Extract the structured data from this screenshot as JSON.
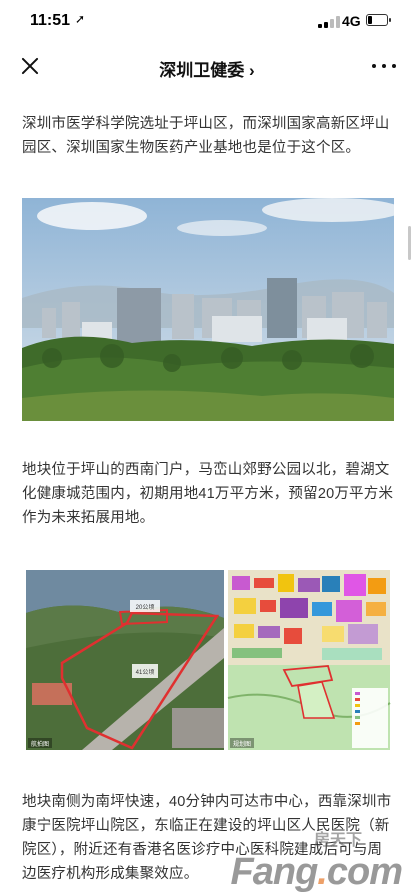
{
  "status": {
    "time": "11:51",
    "location_icon": "location-arrow-icon",
    "network": "4G"
  },
  "nav": {
    "title": "深圳卫健委 ›"
  },
  "paragraphs": {
    "p1": "深圳市医学科学院选址于坪山区，而深圳国家高新区坪山园区、深圳国家生物医药产业基地也是位于这个区。",
    "p2": "地块位于坪山的西南门户，马峦山郊野公园以北，碧湖文化健康城范围内，初期用地41万平方米，预留20万平方米作为未来拓展用地。",
    "p3": "地块南侧为南坪快速，40分钟内可达市中心，西靠深圳市康宁医院坪山院区，东临正在建设的坪山区人民医院（新院区），附近还有香港名医诊疗中心医科院建成后可与周边医疗机构形成集聚效应。"
  },
  "map": {
    "left_caption": "航拍图",
    "right_caption": "规划图",
    "area_label": "41公顷",
    "reserve_label": "20公顷"
  },
  "watermark": {
    "small": "房天下",
    "big": "Fang",
    "dot": ".",
    "suffix": "com"
  }
}
